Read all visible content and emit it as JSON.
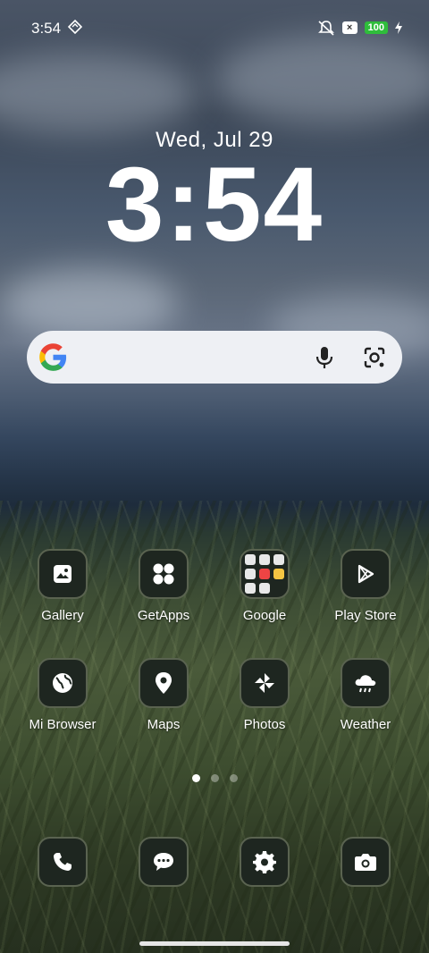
{
  "status_bar": {
    "time": "3:54",
    "battery": "100",
    "x_badge": "×"
  },
  "lock": {
    "date": "Wed, Jul 29",
    "clock": "3:54"
  },
  "search": {
    "mic_icon": "microphone",
    "lens_icon": "google-lens"
  },
  "apps": [
    {
      "label": "Gallery"
    },
    {
      "label": "GetApps"
    },
    {
      "label": "Google"
    },
    {
      "label": "Play Store"
    },
    {
      "label": "Mi Browser"
    },
    {
      "label": "Maps"
    },
    {
      "label": "Photos"
    },
    {
      "label": "Weather"
    }
  ],
  "dock": {
    "items": [
      "phone",
      "messages",
      "settings",
      "camera"
    ]
  },
  "pager": {
    "pages": 3,
    "current": 1
  },
  "colors": {
    "battery": "#2fbd3b",
    "tile_bg": "#1e2620"
  }
}
